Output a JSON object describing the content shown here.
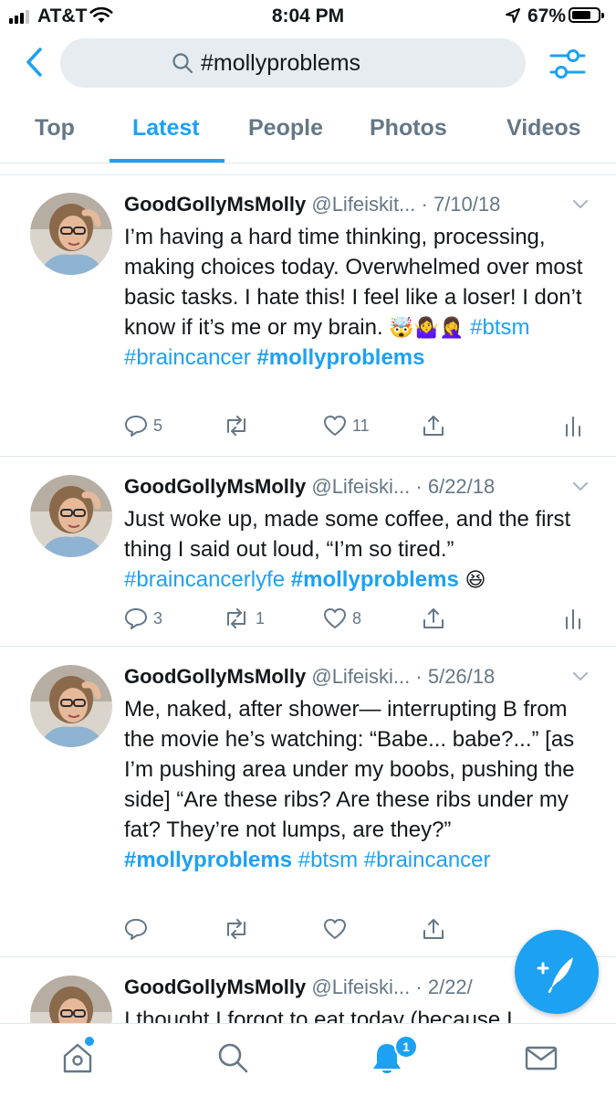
{
  "status_bar": {
    "carrier": "AT&T",
    "time": "8:04 PM",
    "battery_percent": "67%",
    "battery_level": 0.67,
    "icons": [
      "signal-icon",
      "wifi-icon",
      "location-arrow-icon",
      "battery-icon"
    ]
  },
  "search": {
    "query": "#mollyproblems",
    "icons": [
      "back-chevron-icon",
      "search-icon",
      "filter-sliders-icon"
    ]
  },
  "tabs": [
    {
      "label": "Top",
      "active": false
    },
    {
      "label": "Latest",
      "active": true
    },
    {
      "label": "People",
      "active": false
    },
    {
      "label": "Photos",
      "active": false
    },
    {
      "label": "Videos",
      "active": false
    }
  ],
  "tweets": [
    {
      "name": "GoodGollyMsMolly",
      "handle": "@Lifeiskit...",
      "date": "· 7/10/18",
      "text_a": "I’m having a hard time thinking, processing, making choices today. Overwhelmed over most basic tasks. I hate this! I feel like a loser! I don’t know if it’s me or my brain.",
      "emoji": "🤯🤷‍♀️🤦‍♀️",
      "tag_a": "#btsm",
      "tag_b": "#braincancer",
      "tag_c": "#mollyproblems",
      "replies": "5",
      "retweets": "",
      "likes": "11"
    },
    {
      "name": "GoodGollyMsMolly",
      "handle": "@Lifeiski...",
      "date": "· 6/22/18",
      "text_a": "Just woke up, made some coffee, and the first thing I said out loud, “I’m so tired.”",
      "tag_a": "#braincancerlyfe",
      "tag_b": "#mollyproblems",
      "emoji": "😆",
      "replies": "3",
      "retweets": "1",
      "likes": "8"
    },
    {
      "name": "GoodGollyMsMolly",
      "handle": "@Lifeiski...",
      "date": "· 5/26/18",
      "text_a": "Me, naked, after shower— interrupting B from the movie he’s watching: “Babe... babe?...” [as I’m pushing area under my boobs, pushing the side] “Are these ribs? Are these ribs under my fat? They’re not lumps, are they?”",
      "tag_a": "#mollyproblems",
      "tag_b": "#btsm",
      "tag_c": "#braincancer",
      "replies": "",
      "retweets": "",
      "likes": ""
    },
    {
      "name": "GoodGollyMsMolly",
      "handle": "@Lifeiski...",
      "date": "· 2/22/",
      "text_a": "I thought I forgot to eat today (because I"
    }
  ],
  "compose_icon": "compose-feather-icon",
  "bottom_nav": {
    "items": [
      "home-icon",
      "search-icon",
      "notifications-bell-icon",
      "messages-envelope-icon"
    ],
    "notification_count": "1"
  },
  "colors": {
    "accent": "#1da1f2",
    "text": "#14171a",
    "secondary": "#657786",
    "search_bg": "#e6ecf0",
    "divider": "#e1e8ed"
  }
}
